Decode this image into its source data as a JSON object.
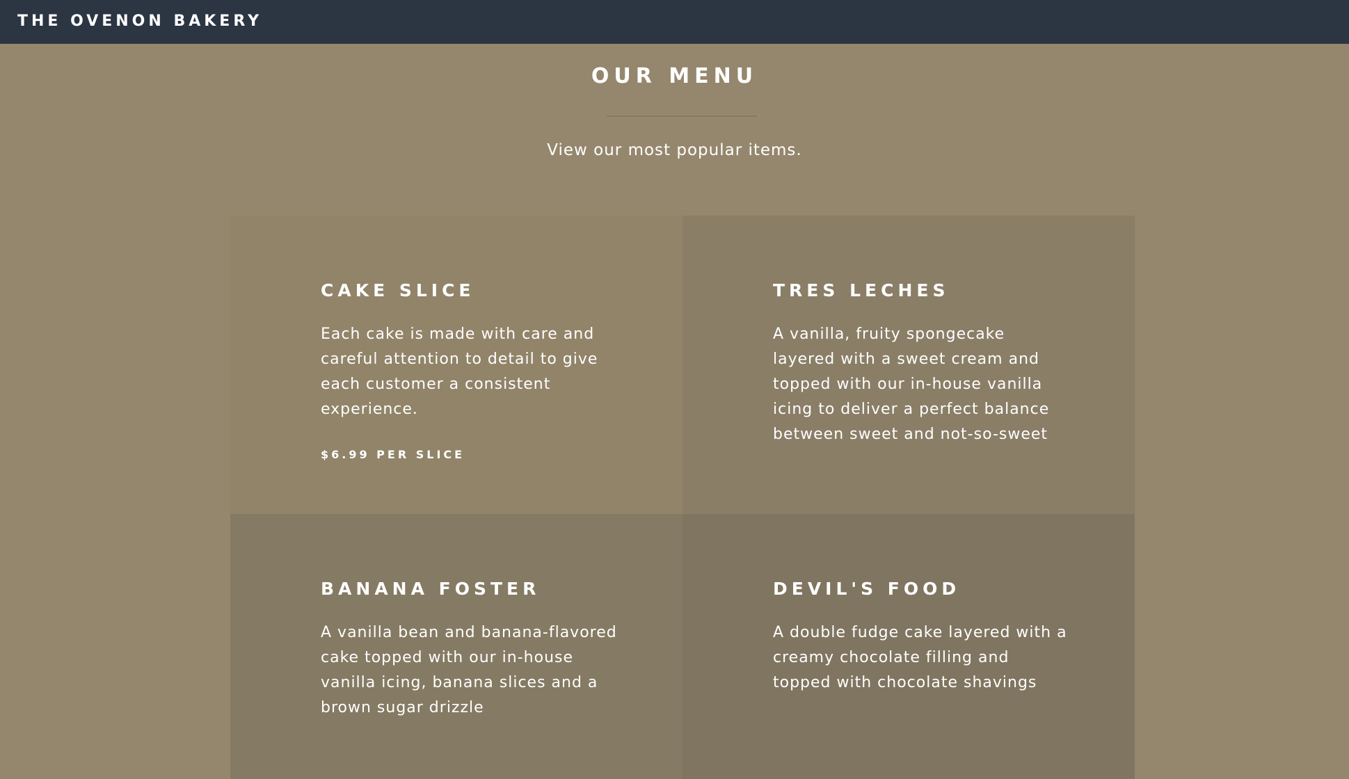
{
  "header": {
    "brand": "THE OVENON BAKERY"
  },
  "menu": {
    "title": "OUR MENU",
    "subtitle": "View our most popular items."
  },
  "items": [
    {
      "title": "CAKE SLICE",
      "description": "Each cake is made with care and careful attention to detail to give each customer a consistent experience.",
      "price": "$6.99 PER SLICE"
    },
    {
      "title": "TRES LECHES",
      "description": "A vanilla, fruity spongecake layered with a sweet cream and topped with our in-house vanilla icing to deliver a perfect balance between sweet and not-so-sweet"
    },
    {
      "title": "BANANA FOSTER",
      "description": "A vanilla bean and banana-flavored cake topped with our in-house vanilla icing, banana slices and a brown sugar drizzle"
    },
    {
      "title": "DEVIL'S FOOD",
      "description": "A double fudge cake layered with a creamy chocolate filling and topped with chocolate shavings"
    }
  ],
  "colors": {
    "navbar": "#2c3542",
    "page_background": "#95876d",
    "text": "#ffffff"
  }
}
